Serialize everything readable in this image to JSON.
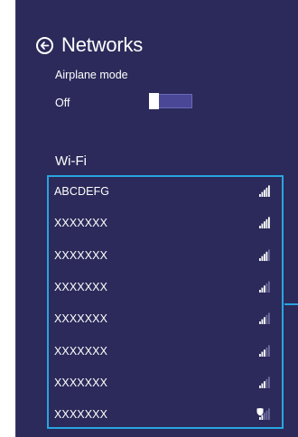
{
  "header": {
    "title": "Networks"
  },
  "airplane_mode": {
    "label": "Airplane mode",
    "state": "Off",
    "enabled": false
  },
  "wifi": {
    "label": "Wi-Fi",
    "networks": [
      {
        "name": "ABCDEFG",
        "signal_bars": 5,
        "secured": false
      },
      {
        "name": "XXXXXXX",
        "signal_bars": 5,
        "secured": false
      },
      {
        "name": "XXXXXXX",
        "signal_bars": 4,
        "secured": false
      },
      {
        "name": "XXXXXXX",
        "signal_bars": 3,
        "secured": false
      },
      {
        "name": "XXXXXXX",
        "signal_bars": 3,
        "secured": false
      },
      {
        "name": "XXXXXXX",
        "signal_bars": 3,
        "secured": false
      },
      {
        "name": "XXXXXXX",
        "signal_bars": 3,
        "secured": false
      },
      {
        "name": "XXXXXXX",
        "signal_bars": 2,
        "secured": true
      }
    ]
  },
  "colors": {
    "panel_bg": "#2b2a5a",
    "selection_border": "#29a5e0",
    "toggle_track": "#4a4896"
  },
  "icons": {
    "back": "back-arrow-circle-icon",
    "signal": "wifi-signal-icon",
    "shield": "shield-icon"
  }
}
